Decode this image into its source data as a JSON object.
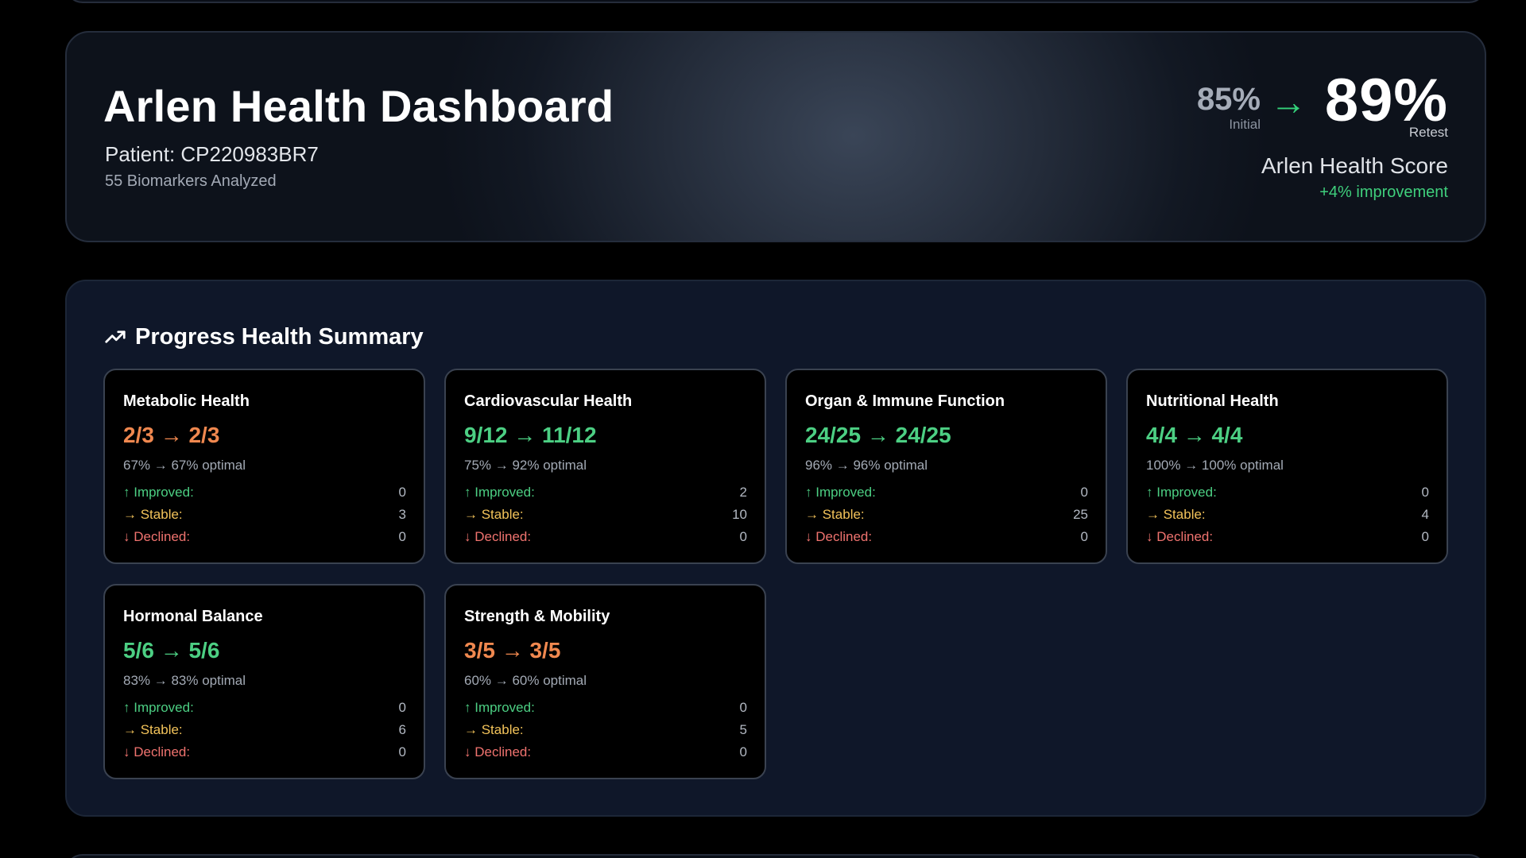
{
  "header": {
    "title": "Arlen Health Dashboard",
    "patient": "Patient: CP220983BR7",
    "biomarkers": "55 Biomarkers Analyzed",
    "score": {
      "initial_value": "85%",
      "initial_label": "Initial",
      "arrow": "→",
      "retest_value": "89%",
      "retest_label": "Retest",
      "name": "Arlen Health Score",
      "improvement": "+4% improvement"
    }
  },
  "summary": {
    "title": "Progress Health Summary",
    "icon": "trending-up-icon",
    "stat_labels": {
      "improved": "↑ Improved:",
      "stable": "→ Stable:",
      "declined": "↓ Declined:"
    },
    "categories": [
      {
        "name": "Metabolic Health",
        "ratio": "2/3 → 2/3",
        "optimal": "67% → 67% optimal",
        "improved": "0",
        "stable": "3",
        "declined": "0",
        "status_color": "#f0884f"
      },
      {
        "name": "Cardiovascular Health",
        "ratio": "9/12 → 11/12",
        "optimal": "75% → 92% optimal",
        "improved": "2",
        "stable": "10",
        "declined": "0",
        "status_color": "#4ccf83"
      },
      {
        "name": "Organ & Immune Function",
        "ratio": "24/25 → 24/25",
        "optimal": "96% → 96% optimal",
        "improved": "0",
        "stable": "25",
        "declined": "0",
        "status_color": "#4ccf83"
      },
      {
        "name": "Nutritional Health",
        "ratio": "4/4 → 4/4",
        "optimal": "100% → 100% optimal",
        "improved": "0",
        "stable": "4",
        "declined": "0",
        "status_color": "#4ccf83"
      },
      {
        "name": "Hormonal Balance",
        "ratio": "5/6 → 5/6",
        "optimal": "83% → 83% optimal",
        "improved": "0",
        "stable": "6",
        "declined": "0",
        "status_color": "#4ccf83"
      },
      {
        "name": "Strength & Mobility",
        "ratio": "3/5 → 3/5",
        "optimal": "60% → 60% optimal",
        "improved": "0",
        "stable": "5",
        "declined": "0",
        "status_color": "#f0884f"
      }
    ]
  },
  "colors": {
    "improved": "#4ccf83",
    "stable": "#f3c35a",
    "declined": "#f0736f",
    "accent_green": "#34d17a",
    "section_bg": "#0f1729"
  }
}
